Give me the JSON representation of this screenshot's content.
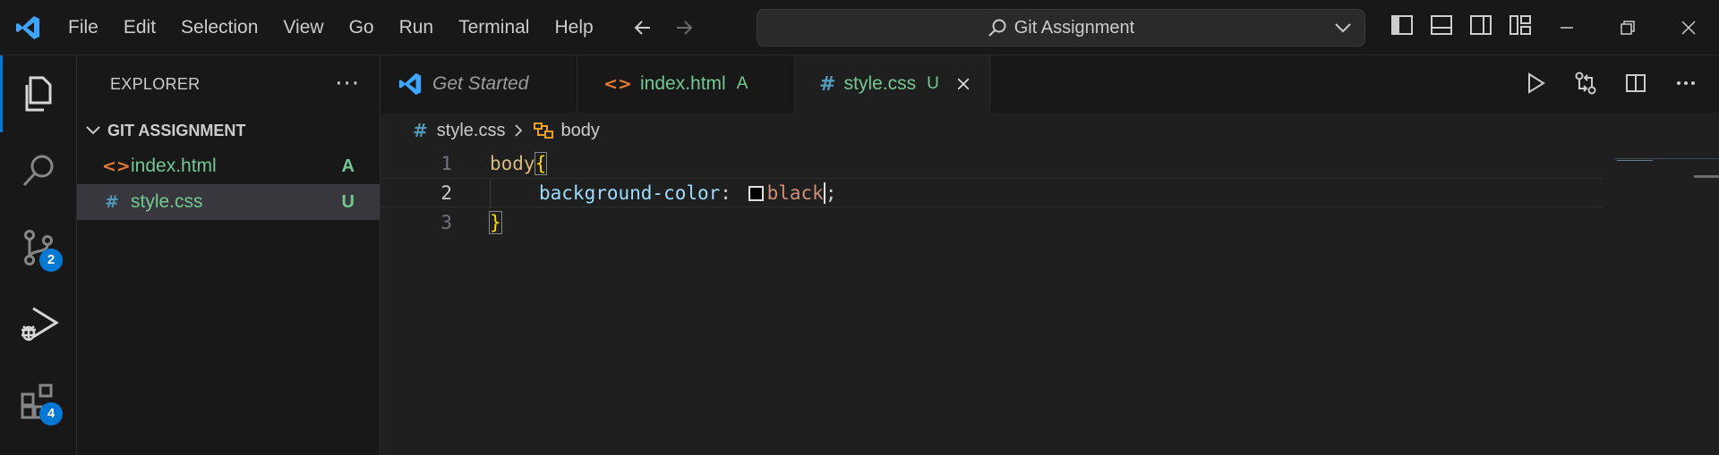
{
  "titlebar": {
    "menu": [
      "File",
      "Edit",
      "Selection",
      "View",
      "Go",
      "Run",
      "Terminal",
      "Help"
    ],
    "command_center": "Git Assignment"
  },
  "activitybar": {
    "source_control_badge": "2",
    "extensions_badge": "4"
  },
  "sidebar": {
    "title": "EXPLORER",
    "more": "···",
    "section_title": "GIT ASSIGNMENT",
    "files": [
      {
        "name": "index.html",
        "status": "A",
        "icon": "<>",
        "color": "#73c991",
        "status_color": "#73c991"
      },
      {
        "name": "style.css",
        "status": "U",
        "icon": "#",
        "color": "#73c991",
        "status_color": "#73c991"
      }
    ]
  },
  "tabs": [
    {
      "label": "Get Started",
      "status": ""
    },
    {
      "label": "index.html",
      "status": "A"
    },
    {
      "label": "style.css",
      "status": "U"
    }
  ],
  "breadcrumbs": {
    "file": "style.css",
    "symbol": "body"
  },
  "editor": {
    "lines": [
      {
        "number": "1",
        "selector": "body",
        "brace_open": "{"
      },
      {
        "number": "2",
        "property": "background-color",
        "colon": ":",
        "value": "black",
        "semicolon": ";"
      },
      {
        "number": "3",
        "brace_close": "}"
      }
    ]
  },
  "colors": {
    "accent": "#0078d4",
    "git_added": "#73c991",
    "html_icon": "#e37933",
    "css_icon": "#519aba"
  }
}
